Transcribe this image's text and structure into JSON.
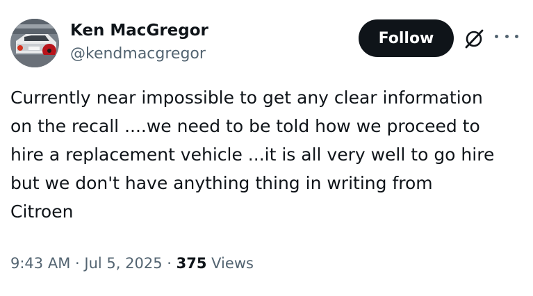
{
  "author": {
    "display_name": "Ken MacGregor",
    "handle": "@kendmacgregor"
  },
  "actions": {
    "follow_label": "Follow"
  },
  "tweet": {
    "text": "Currently near impossible to get any clear information\non the recall ....we need to be told how we proceed to\nhire a replacement vehicle ...it is all very well to go hire\nbut we don't have anything thing in writing from\nCitroen"
  },
  "meta": {
    "time": "9:43 AM",
    "separator": "·",
    "date": "Jul 5, 2025",
    "views_count": "375",
    "views_label": "Views"
  },
  "icons": {
    "avatar": "avatar-photo-car-with-poppy",
    "grok": "grok-icon",
    "more": "more-icon"
  },
  "colors": {
    "follow_bg": "#0f1419",
    "secondary_text": "#536471",
    "primary_text": "#0f1419"
  }
}
